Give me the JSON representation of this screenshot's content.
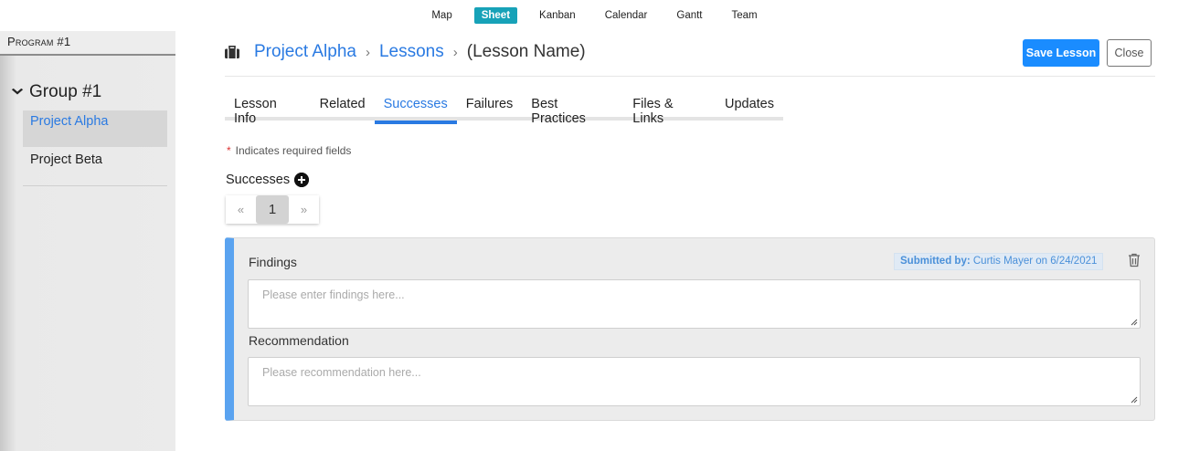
{
  "topnav": {
    "items": [
      "Map",
      "Sheet",
      "Kanban",
      "Calendar",
      "Gantt",
      "Team"
    ],
    "active": "Sheet"
  },
  "sidebar": {
    "program": "Program #1",
    "group": "Group #1",
    "projects": [
      "Project Alpha",
      "Project Beta"
    ],
    "active_project": "Project Alpha"
  },
  "breadcrumb": {
    "project": "Project Alpha",
    "section": "Lessons",
    "current": "(Lesson Name)",
    "separator": "›"
  },
  "actions": {
    "save_label": "Save Lesson",
    "close_label": "Close"
  },
  "tabs": {
    "items": [
      "Lesson Info",
      "Related",
      "Successes",
      "Failures",
      "Best Practices",
      "Files & Links",
      "Updates"
    ],
    "active": "Successes"
  },
  "form": {
    "required_note": "Indicates required fields",
    "required_marker": "*",
    "section_label": "Successes"
  },
  "pagination": {
    "prev": "«",
    "current": "1",
    "next": "»"
  },
  "entry": {
    "findings_label": "Findings",
    "findings_placeholder": "Please enter findings here...",
    "recommendation_label": "Recommendation",
    "recommendation_placeholder": "Please recommendation here...",
    "submitted_prefix": "Submitted by:",
    "submitted_text": "Curtis Mayer on 6/24/2021"
  },
  "colors": {
    "accent": "#2a7ae2",
    "save_button": "#1a8cff",
    "active_nav": "#17a2b8",
    "card_stripe": "#5aa3f0"
  },
  "icons": [
    "briefcase-icon",
    "chevron-down-icon",
    "plus-circle-icon",
    "trash-icon",
    "resize-grip-icon"
  ]
}
